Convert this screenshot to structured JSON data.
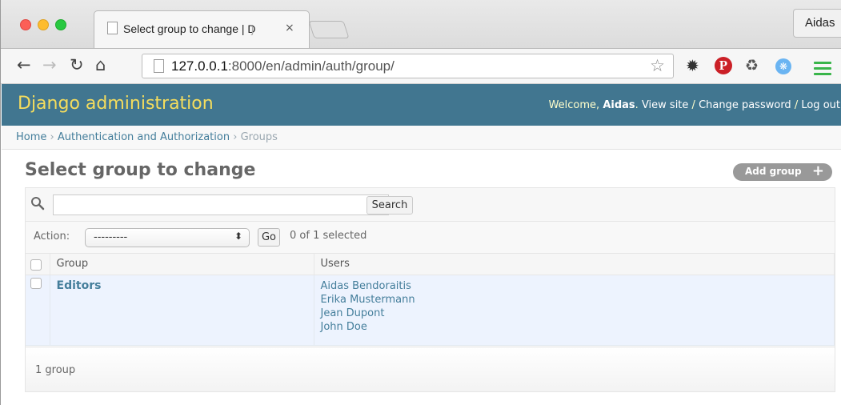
{
  "browser": {
    "tab_title": "Select group to change | D",
    "tab_title_fade": "j",
    "tab_close": "×",
    "profile_name": "Aidas",
    "url_host": "127.0.0.1",
    "url_path": ":8000/en/admin/auth/group/",
    "icons": {
      "back": "back-arrow-icon",
      "forward": "forward-arrow-icon",
      "reload": "reload-icon",
      "home": "home-icon",
      "star": "bookmark-star-icon",
      "menu": "hamburger-menu-icon"
    },
    "colors": {
      "menu_green": "#39b54a",
      "pinterest_red": "#cb2027"
    }
  },
  "admin": {
    "branding": "Django administration",
    "welcome_prefix": "Welcome,",
    "username": "Aidas",
    "welcome_suffix": ".",
    "view_site": "View site",
    "sep1": " / ",
    "change_password": "Change password",
    "sep2": " / ",
    "log_out": "Log out",
    "colors": {
      "header_bg": "#417690",
      "branding": "#f5dd5d",
      "link": "#447e9b"
    }
  },
  "breadcrumbs": {
    "home": "Home",
    "sep1": " › ",
    "app": "Authentication and Authorization",
    "sep2": " › ",
    "current": "Groups"
  },
  "page": {
    "title": "Select group to change",
    "add_button": "Add group",
    "add_plus": "+"
  },
  "search": {
    "value": "",
    "placeholder": "",
    "button": "Search"
  },
  "actions": {
    "label": "Action:",
    "selected_option": "---------",
    "go_button": "Go",
    "counter": "0 of 1 selected"
  },
  "table": {
    "headers": [
      "Group",
      "Users"
    ],
    "rows": [
      {
        "group": "Editors",
        "users": [
          "Aidas Bendoraitis",
          "Erika Mustermann",
          "Jean Dupont",
          "John Doe"
        ]
      }
    ]
  },
  "paginator": {
    "text": "1 group"
  }
}
